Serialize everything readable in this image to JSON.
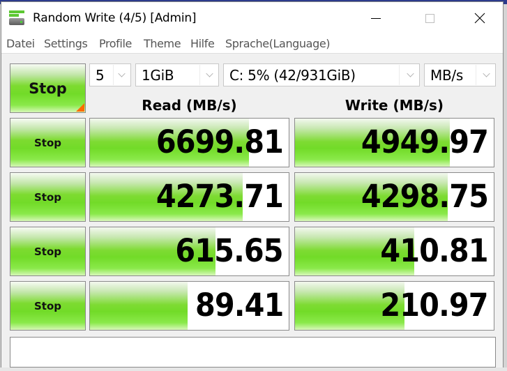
{
  "window": {
    "title": "Random Write (4/5) [Admin]",
    "icon": "disk-drive-icon"
  },
  "menu": [
    "Datei",
    "Settings",
    "Profile",
    "Theme",
    "Hilfe",
    "Sprache(Language)"
  ],
  "controls": {
    "main_button_label": "Stop",
    "count": "5",
    "size": "1GiB",
    "drive": "C: 5% (42/931GiB)",
    "unit": "MB/s"
  },
  "columns": {
    "read": "Read (MB/s)",
    "write": "Write (MB/s)"
  },
  "rows": [
    {
      "button": "Stop",
      "read": "6699.81",
      "read_fill": 0.8,
      "write": "4949.97",
      "write_fill": 0.78
    },
    {
      "button": "Stop",
      "read": "4273.71",
      "read_fill": 0.77,
      "write": "4298.75",
      "write_fill": 0.77
    },
    {
      "button": "Stop",
      "read": "615.65",
      "read_fill": 0.63,
      "write": "410.81",
      "write_fill": 0.6
    },
    {
      "button": "Stop",
      "read": "89.41",
      "read_fill": 0.49,
      "write": "210.97",
      "write_fill": 0.55
    }
  ],
  "comment": "",
  "colors": {
    "bar_green": "#72db28",
    "corner_orange": "#ff6a00"
  }
}
